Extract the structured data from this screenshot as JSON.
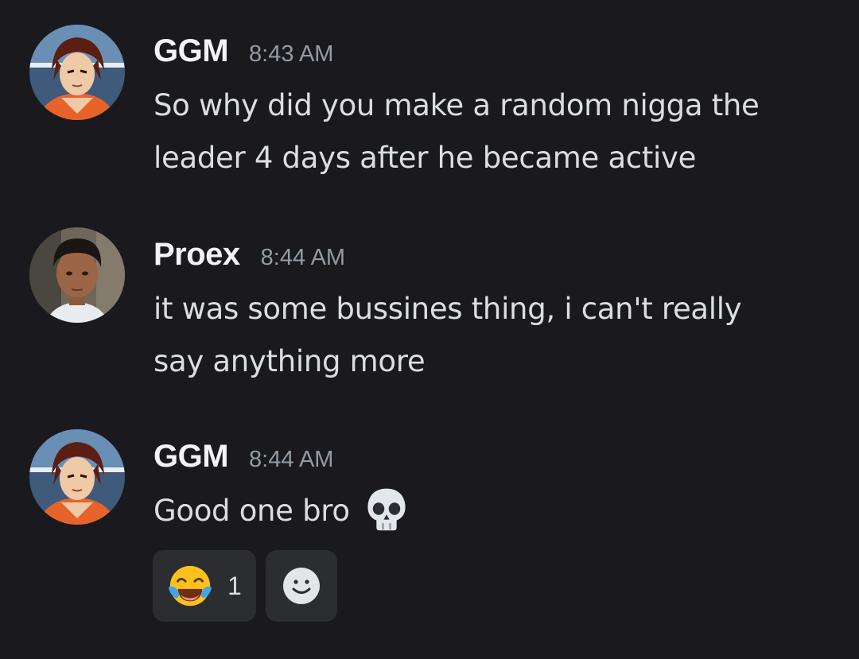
{
  "messages": [
    {
      "author": "GGM",
      "time": "8:43 AM",
      "avatar": "anime-character-avatar",
      "lines": [
        "So why did you make a random nigga the",
        "leader 4 days after he became active"
      ]
    },
    {
      "author": "Proex",
      "time": "8:44 AM",
      "avatar": "photo-avatar",
      "lines": [
        "it was some bussines thing, i can't really",
        "say anything more"
      ]
    },
    {
      "author": "GGM",
      "time": "8:44 AM",
      "avatar": "anime-character-avatar",
      "text": "Good one bro",
      "emoji": "skull-emoji"
    }
  ],
  "reactions": [
    {
      "emoji": "tears-of-joy-emoji",
      "count": "1"
    },
    {
      "emoji": "add-reaction-icon"
    }
  ],
  "colors": {
    "background": "#1a1a1e",
    "username": "#f2f3f5",
    "timestamp": "#949ba4",
    "text": "#dbdee1",
    "reaction_bg": "#2b2d31"
  }
}
